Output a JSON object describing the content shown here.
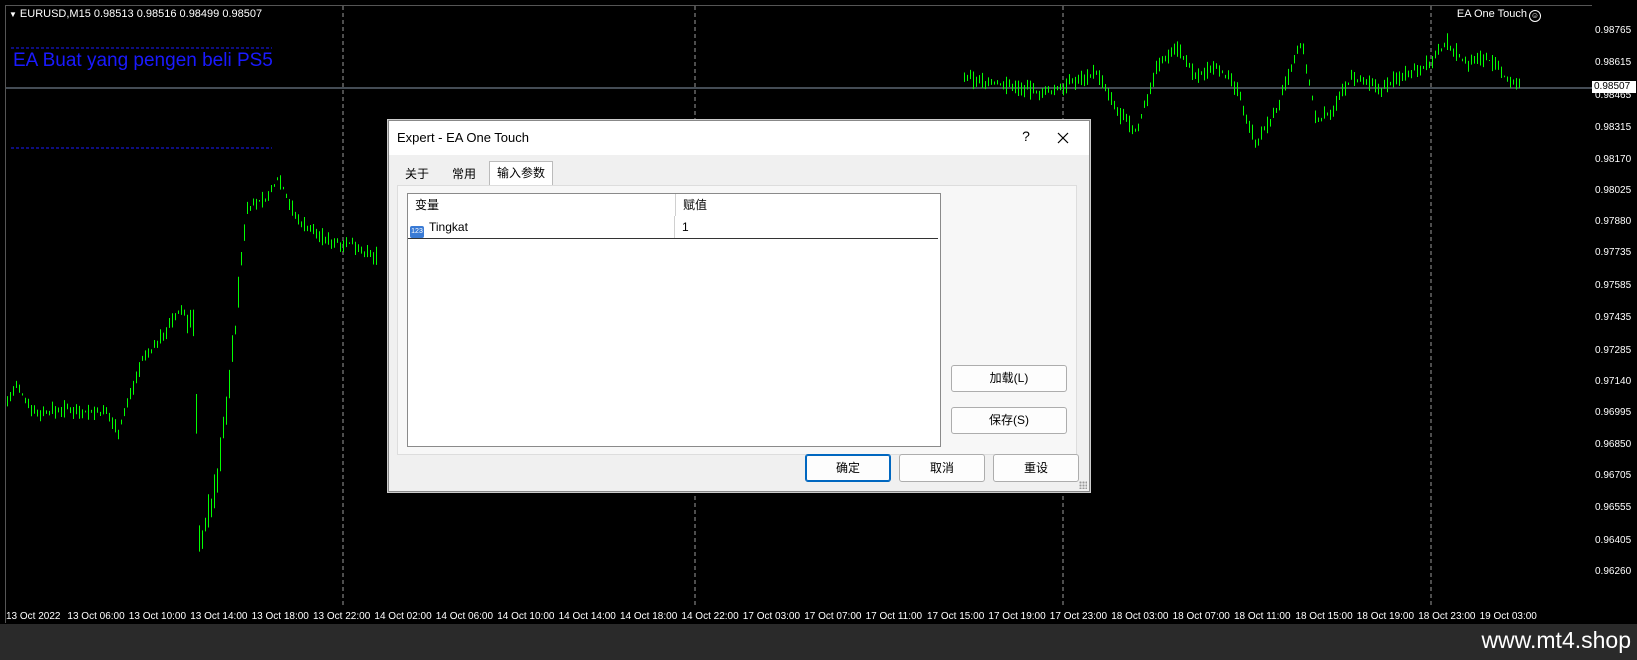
{
  "chart": {
    "symbol_header": "EURUSD,M15  0.98513 0.98516 0.98499 0.98507",
    "ea_name": "EA One Touch",
    "smile_icon": "smiley-face-icon",
    "object_text": "EA Buat yang pengen beli PS5",
    "object_text_color": "#1a1aff",
    "candle_color": "#00ff00",
    "current_price": "0.98507",
    "price_labels": [
      "0.98765",
      "0.98615",
      "0.98465",
      "0.98315",
      "0.98170",
      "0.98025",
      "0.97880",
      "0.97735",
      "0.97585",
      "0.97435",
      "0.97285",
      "0.97140",
      "0.96995",
      "0.96850",
      "0.96705",
      "0.96555",
      "0.96405",
      "0.96260"
    ],
    "time_labels": [
      "13 Oct 2022",
      "13 Oct 06:00",
      "13 Oct 10:00",
      "13 Oct 14:00",
      "13 Oct 18:00",
      "13 Oct 22:00",
      "14 Oct 02:00",
      "14 Oct 06:00",
      "14 Oct 10:00",
      "14 Oct 14:00",
      "14 Oct 18:00",
      "14 Oct 22:00",
      "17 Oct 03:00",
      "17 Oct 07:00",
      "17 Oct 11:00",
      "17 Oct 15:00",
      "17 Oct 19:00",
      "17 Oct 23:00",
      "18 Oct 03:00",
      "18 Oct 07:00",
      "18 Oct 11:00",
      "18 Oct 15:00",
      "18 Oct 19:00",
      "18 Oct 23:00",
      "19 Oct 03:00"
    ]
  },
  "watermark": "www.mt4.shop",
  "dialog": {
    "title": "Expert - EA One Touch",
    "help": "?",
    "tabs": [
      "关于",
      "常用",
      "输入参数"
    ],
    "active_tab": "输入参数",
    "columns": [
      "变量",
      "赋值"
    ],
    "rows": [
      {
        "icon": "123",
        "name": "Tingkat",
        "value": "1"
      }
    ],
    "side_buttons": [
      "加载(L)",
      "保存(S)"
    ],
    "bottom_buttons": [
      "确定",
      "取消",
      "重设"
    ]
  }
}
